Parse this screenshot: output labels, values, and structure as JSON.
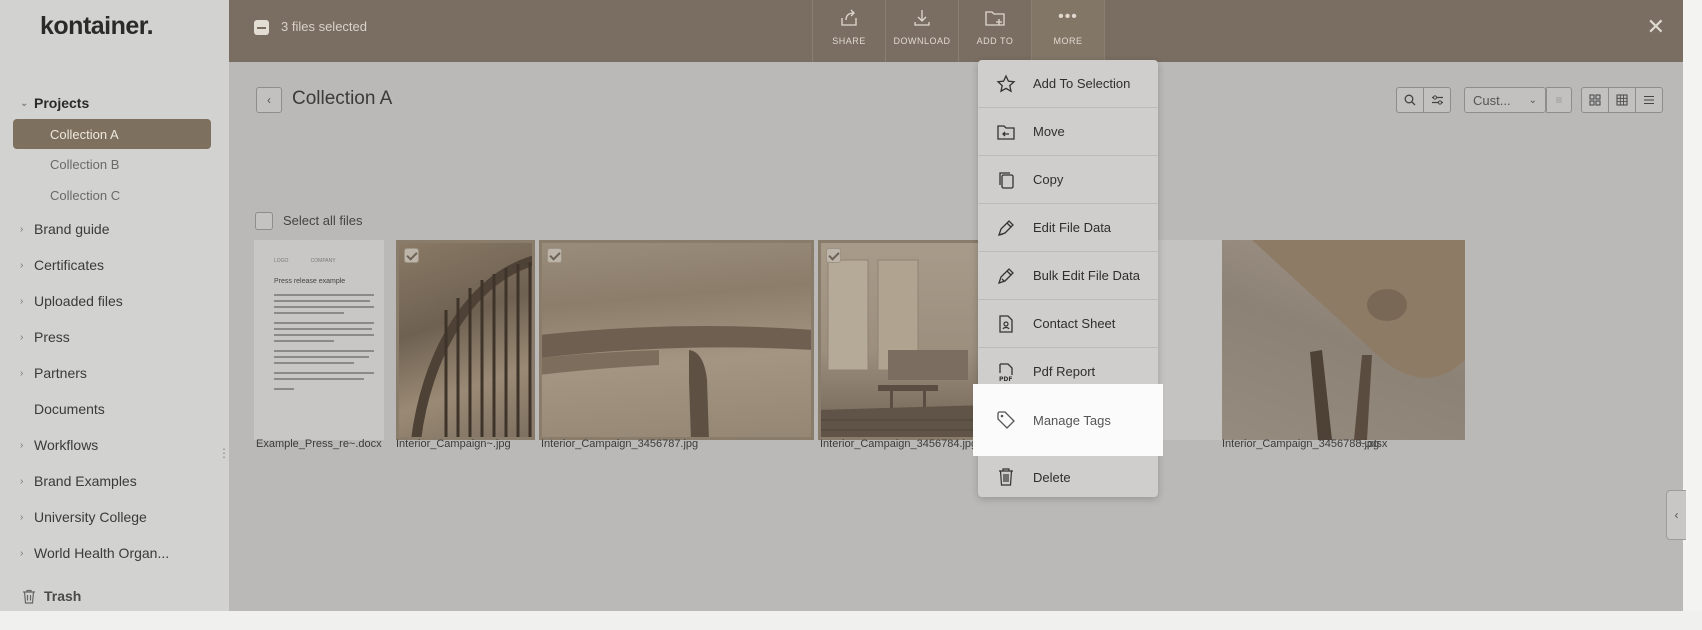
{
  "app": {
    "logo": "kontainer."
  },
  "sidebar": {
    "projects": "Projects",
    "collections": [
      "Collection A",
      "Collection B",
      "Collection C"
    ],
    "items": [
      "Brand guide",
      "Certificates",
      "Uploaded files",
      "Press",
      "Partners"
    ],
    "documents": "Documents",
    "items2": [
      "Workflows",
      "Brand Examples",
      "University College",
      "World Health Organ..."
    ],
    "trash": "Trash"
  },
  "toolbar": {
    "selected": "3 files selected",
    "share": "SHARE",
    "download": "DOWNLOAD",
    "add_to": "ADD TO",
    "more": "MORE"
  },
  "main": {
    "title": "Collection A",
    "sort": "Cust...",
    "select_all": "Select all files"
  },
  "files": [
    {
      "name": "Example_Press_re~.docx",
      "selected": false
    },
    {
      "name": "Interior_Campaign~.jpg",
      "selected": true
    },
    {
      "name": "Interior_Campaign_3456787.jpg",
      "selected": true
    },
    {
      "name": "Interior_Campaign_3456784.jpg",
      "selected": true
    },
    {
      "name": "~.xlsx",
      "selected": false
    },
    {
      "name": "Interior_Campaign_3456788.jpg",
      "selected": false
    }
  ],
  "doc_preview": {
    "heading": "Press release example"
  },
  "menu": {
    "items": [
      "Add To Selection",
      "Move",
      "Copy",
      "Edit File Data",
      "Bulk Edit File Data",
      "Contact Sheet",
      "Pdf Report",
      "Manage Tags",
      "Delete"
    ]
  },
  "colors": {
    "accent": "#7d705f",
    "toolbar": "#7a6e62"
  }
}
